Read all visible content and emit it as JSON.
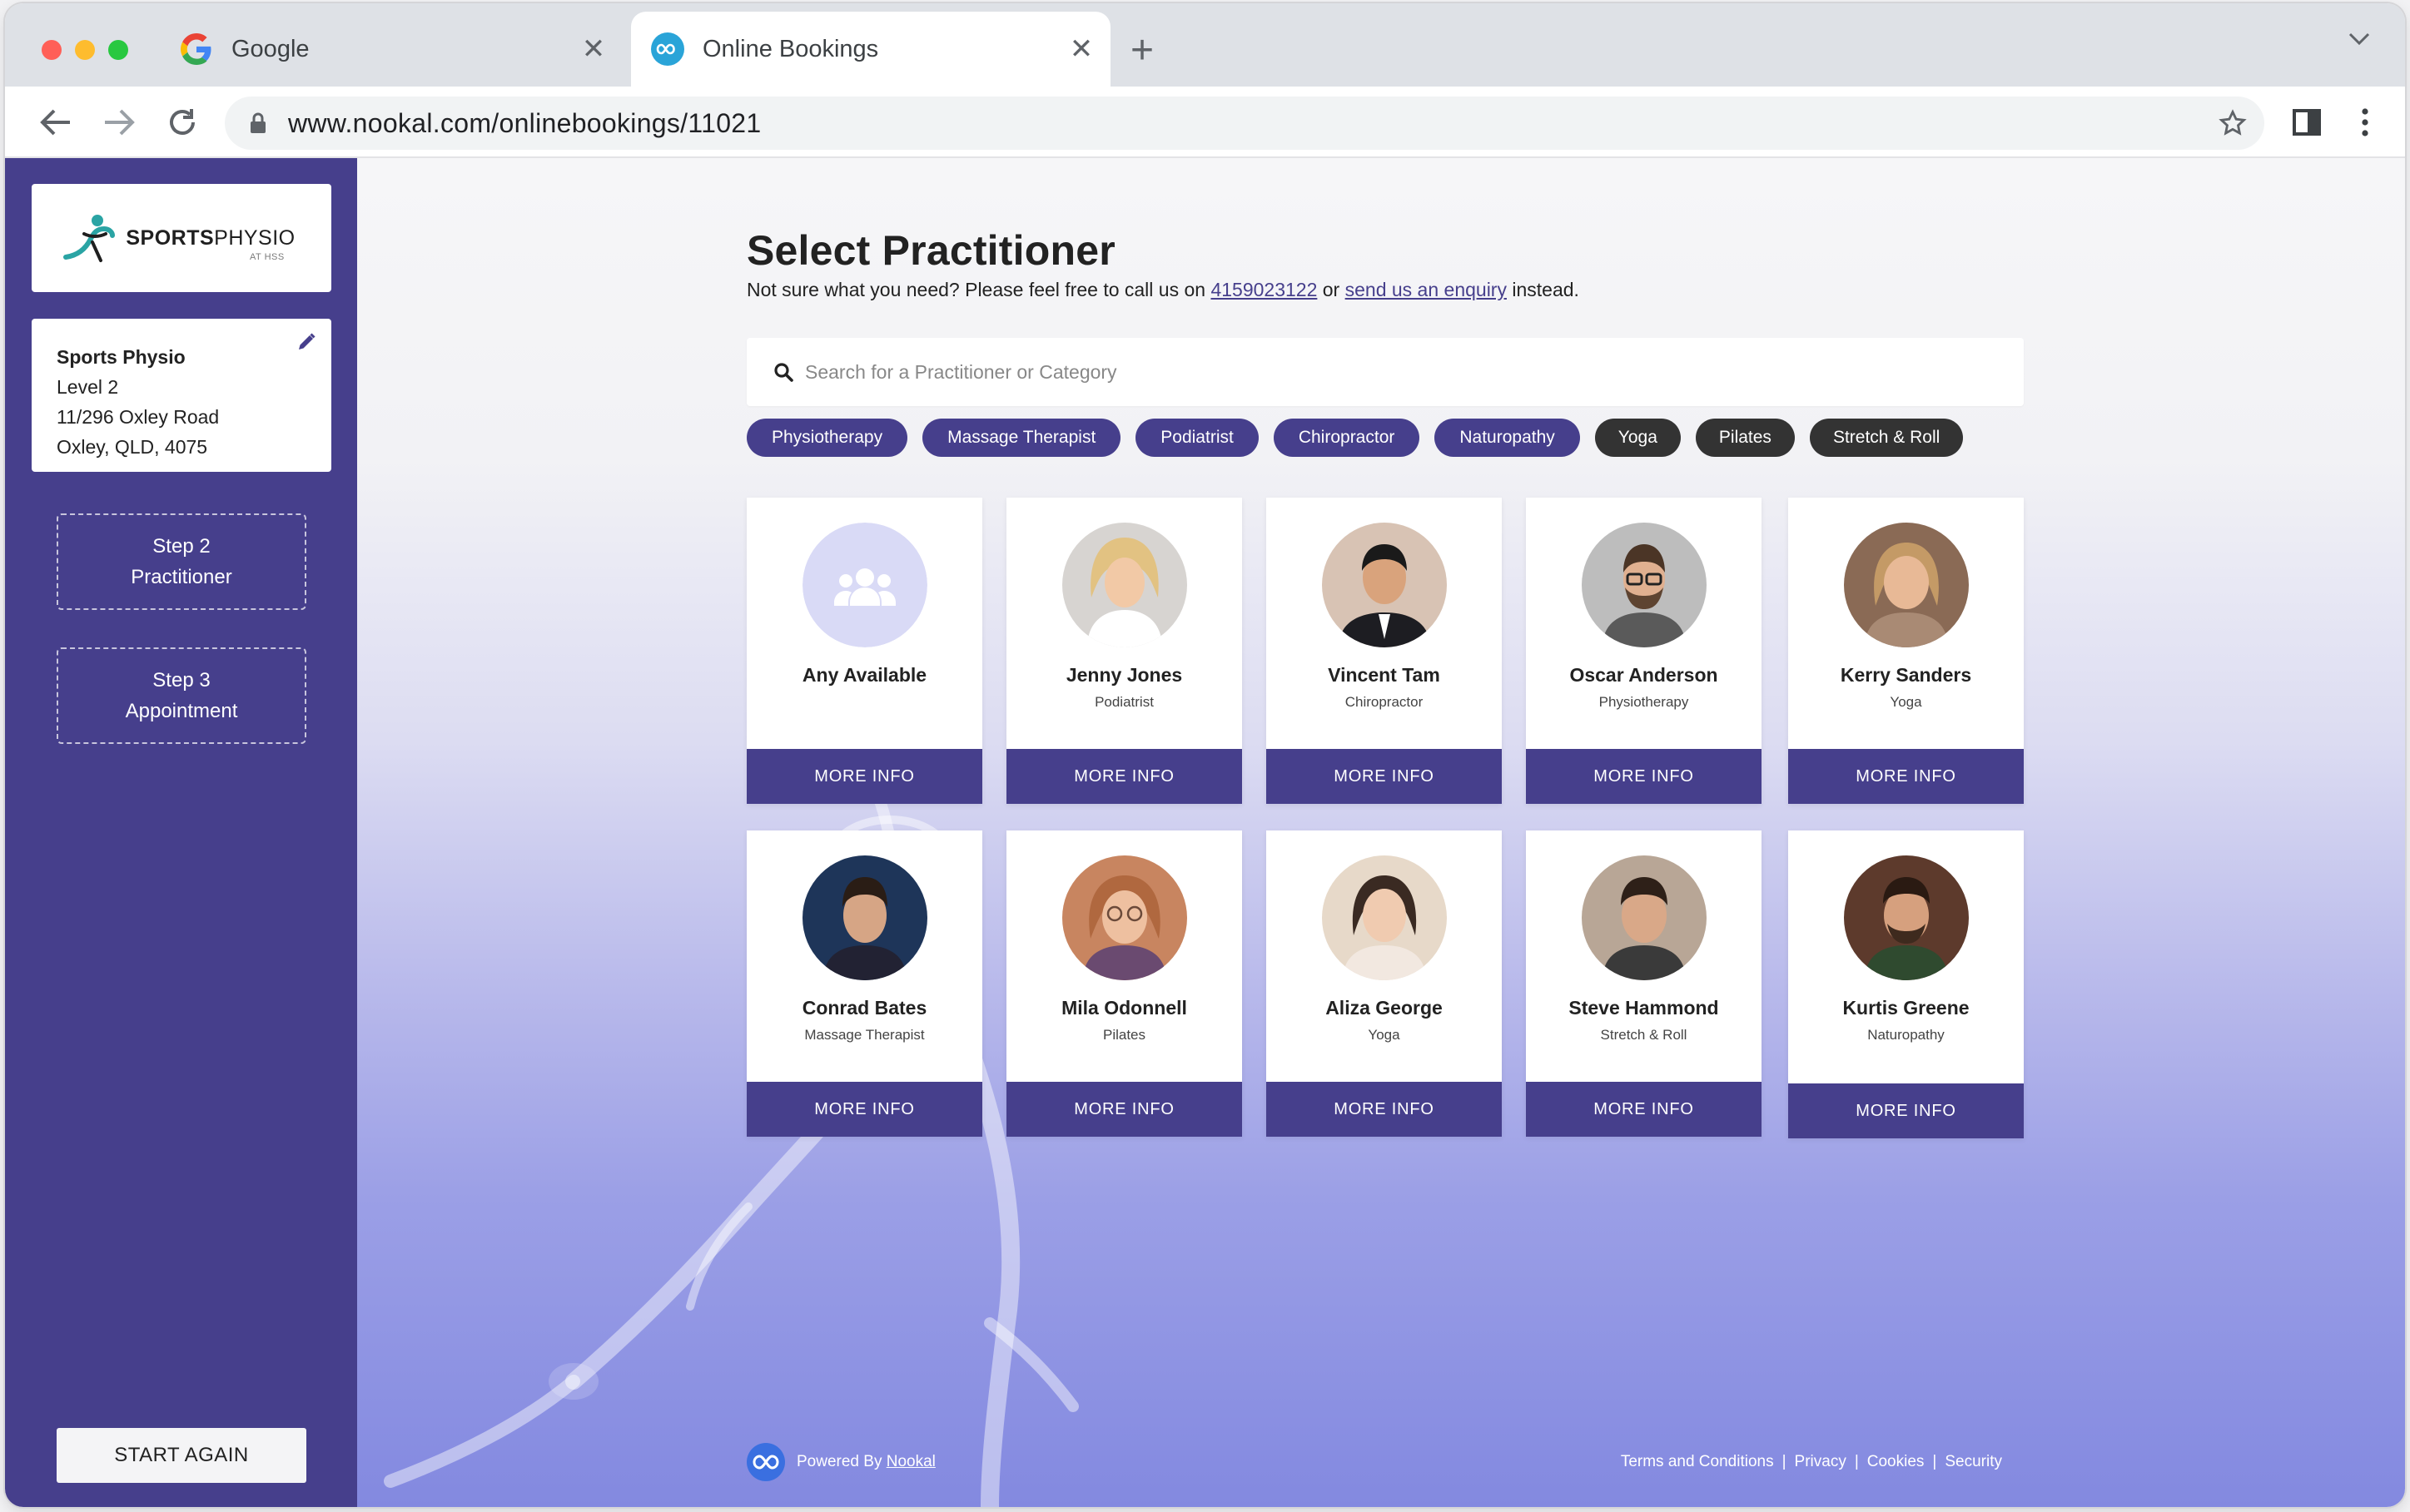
{
  "browser": {
    "tabs": [
      {
        "title": "Google"
      },
      {
        "title": "Online Bookings"
      }
    ],
    "new_tab_label": "+",
    "close_glyph": "✕",
    "url": "www.nookal.com/onlinebookings/11021"
  },
  "sidebar": {
    "logo": {
      "brand_bold": "SPORTS",
      "brand_light": "PHYSIO",
      "sub": "AT HSS"
    },
    "clinic": {
      "name": "Sports Physio",
      "line1": "Level 2",
      "line2": "11/296 Oxley Road",
      "line3": "Oxley, QLD, 4075"
    },
    "steps": [
      {
        "label": "Step 2",
        "name": "Practitioner"
      },
      {
        "label": "Step 3",
        "name": "Appointment"
      }
    ],
    "start_again": "START AGAIN"
  },
  "main": {
    "title": "Select Practitioner",
    "subtitle_pre": "Not sure what you need? Please feel free to call us on ",
    "phone": "4159023122",
    "subtitle_mid": " or ",
    "enquiry_link": "send us an enquiry",
    "subtitle_post": " instead.",
    "search_placeholder": "Search for a Practitioner or Category",
    "categories": [
      "Physiotherapy",
      "Massage Therapist",
      "Podiatrist",
      "Chiropractor",
      "Naturopathy",
      "Yoga",
      "Pilates",
      "Stretch & Roll"
    ],
    "more_info_label": "MORE INFO",
    "practitioners": [
      {
        "name": "Any Available",
        "role": ""
      },
      {
        "name": "Jenny Jones",
        "role": "Podiatrist"
      },
      {
        "name": "Vincent Tam",
        "role": "Chiropractor"
      },
      {
        "name": "Oscar Anderson",
        "role": "Physiotherapy"
      },
      {
        "name": "Kerry Sanders",
        "role": "Yoga"
      },
      {
        "name": "Conrad Bates",
        "role": "Massage Therapist"
      },
      {
        "name": "Mila Odonnell",
        "role": "Pilates"
      },
      {
        "name": "Aliza George",
        "role": "Yoga"
      },
      {
        "name": "Steve Hammond",
        "role": "Stretch & Roll"
      },
      {
        "name": "Kurtis Greene",
        "role": "Naturopathy"
      }
    ]
  },
  "footer": {
    "powered_by": "Powered By ",
    "brand_link": "Nookal",
    "links": [
      "Terms and Conditions",
      "Privacy",
      "Cookies",
      "Security"
    ],
    "separator": "|"
  },
  "colors": {
    "primary": "#463f8c",
    "chip_dark": "#333333",
    "tab_strip": "#dee1e6",
    "close_red": "#ff5f57",
    "minimize_yellow": "#febc2e",
    "maximize_green": "#28c840"
  }
}
